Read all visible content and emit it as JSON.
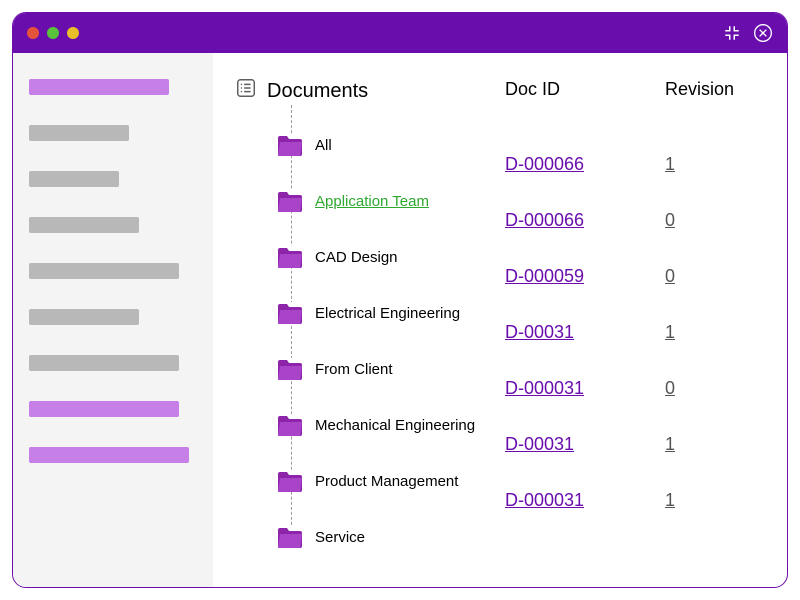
{
  "titlebar": {},
  "sidebar": {
    "items": [
      {
        "variant": "purple",
        "w": 140
      },
      {
        "variant": "grey",
        "w": 100
      },
      {
        "variant": "grey",
        "w": 90
      },
      {
        "variant": "grey",
        "w": 110
      },
      {
        "variant": "grey",
        "w": 150
      },
      {
        "variant": "grey",
        "w": 110
      },
      {
        "variant": "grey",
        "w": 150
      },
      {
        "variant": "purple",
        "w": 150
      },
      {
        "variant": "purple",
        "w": 160
      }
    ]
  },
  "tree": {
    "header": "Documents",
    "items": [
      {
        "label": "All",
        "active": false
      },
      {
        "label": "Application Team ",
        "active": true
      },
      {
        "label": "CAD Design",
        "active": false
      },
      {
        "label": "Electrical Engineering",
        "active": false
      },
      {
        "label": "From Client",
        "active": false
      },
      {
        "label": "Mechanical Engineering",
        "active": false
      },
      {
        "label": "Product Management",
        "active": false
      },
      {
        "label": "Service",
        "active": false
      }
    ]
  },
  "docCol": {
    "header": "Doc ID",
    "rows": [
      {
        "id": "D-000066",
        "rev": "1"
      },
      {
        "id": "D-000066",
        "rev": "0"
      },
      {
        "id": "D-000059",
        "rev": "0"
      },
      {
        "id": "D-00031",
        "rev": "1"
      },
      {
        "id": "D-000031",
        "rev": "0"
      },
      {
        "id": "D-00031",
        "rev": "1"
      },
      {
        "id": "D-000031",
        "rev": "1"
      }
    ]
  },
  "revHeader": "Revision"
}
